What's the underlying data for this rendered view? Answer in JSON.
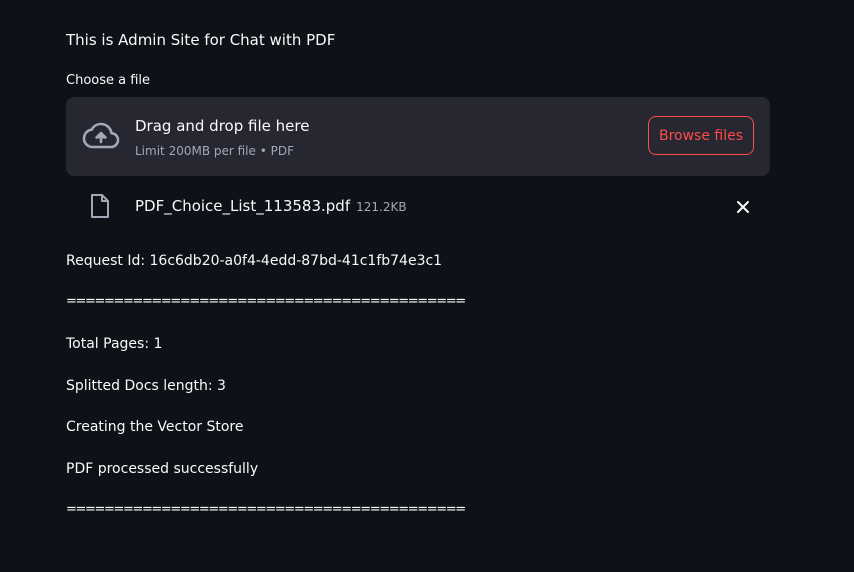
{
  "app": {
    "title": "This is Admin Site for Chat with PDF"
  },
  "uploader": {
    "label": "Choose a file",
    "drop_text": "Drag and drop file here",
    "limit_text": "Limit 200MB per file • PDF",
    "browse_label": "Browse files",
    "icon": "cloud-upload-icon"
  },
  "uploaded_file": {
    "name": "PDF_Choice_List_113583.pdf",
    "size": "121.2KB",
    "icon": "file-icon",
    "remove_icon": "close-icon"
  },
  "output": {
    "request_id": "Request Id: 16c6db20-a0f4-4edd-87bd-41c1fb74e3c1",
    "separator_1": "==========================================",
    "total_pages": "Total Pages: 1",
    "splitted_docs": "Splitted Docs length: 3",
    "vector_store": "Creating the Vector Store",
    "processed": "PDF processed successfully",
    "separator_2": "=========================================="
  },
  "colors": {
    "background": "#0e1117",
    "surface": "#262730",
    "accent": "#ff4b4b",
    "muted_text": "#a3a8b8",
    "text": "#fafafa"
  }
}
